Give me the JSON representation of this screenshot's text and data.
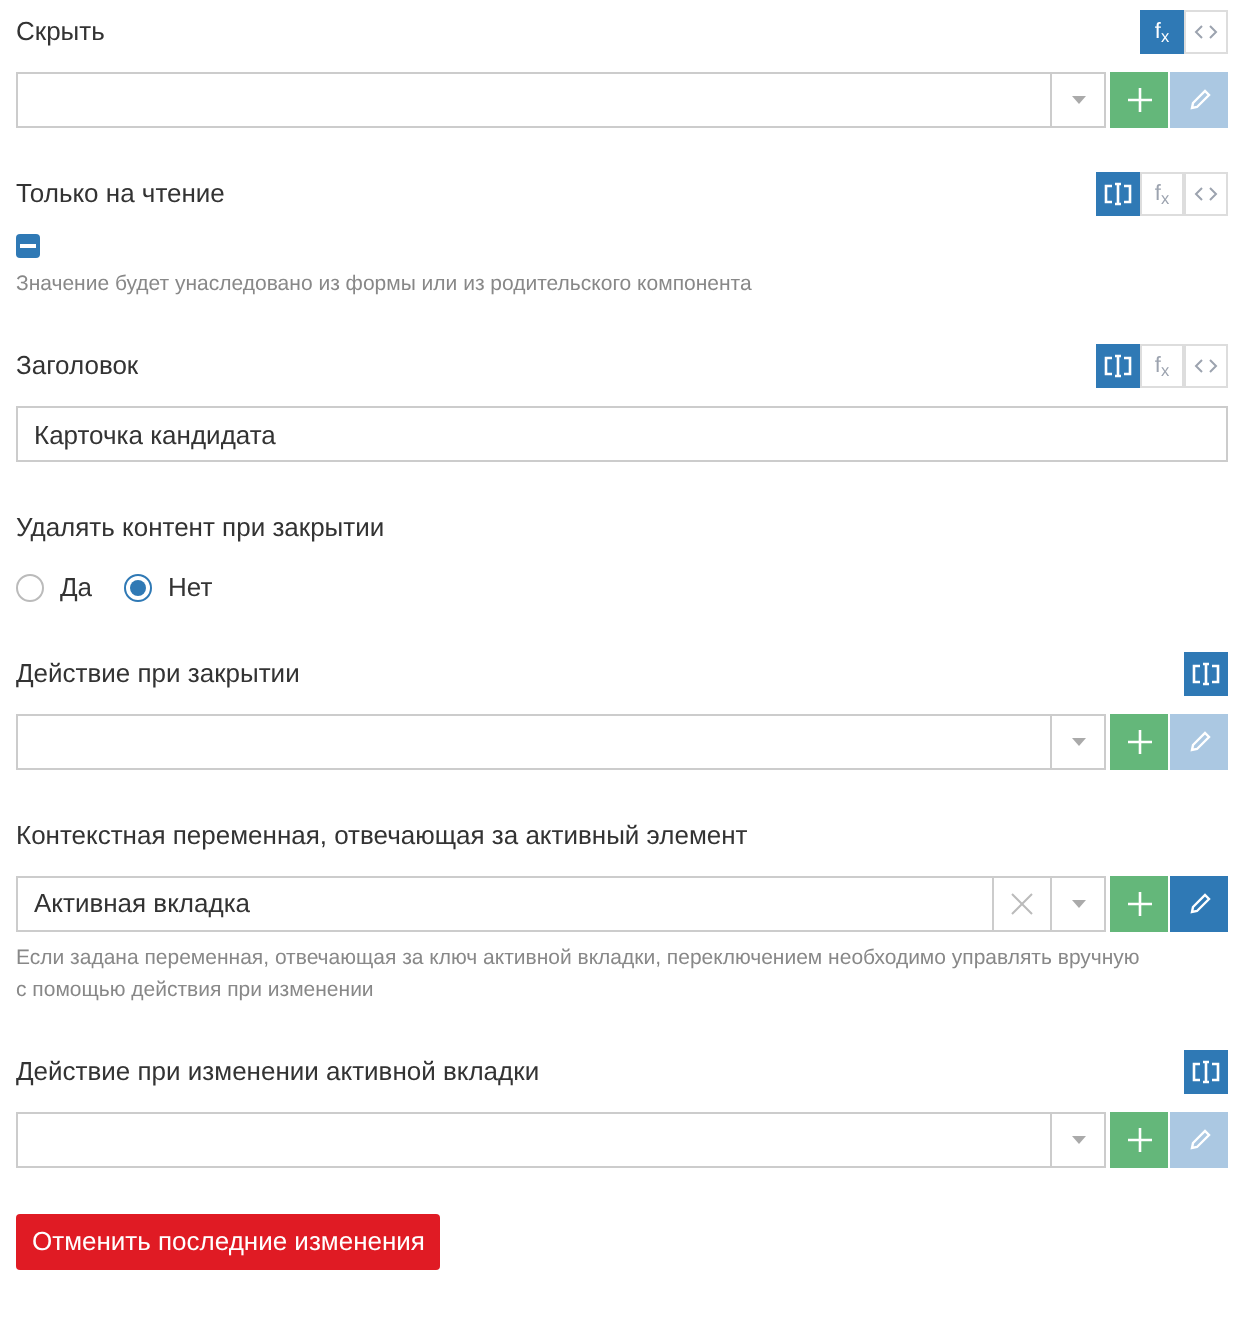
{
  "fields": [
    {
      "kind": "select",
      "label": "Скрыть",
      "modes": [
        {
          "kind": "fx",
          "label": "f$_{x}$",
          "selected": true
        },
        {
          "kind": "code",
          "selected": false
        }
      ],
      "clearable": false,
      "edit_disabled": true
    },
    {
      "kind": "checkbox",
      "label": "Только на чтение",
      "modes": [
        {
          "kind": "binding",
          "selected": true
        },
        {
          "kind": "fx",
          "label": "f$_{x}$",
          "selected": false
        },
        {
          "kind": "code",
          "selected": false
        }
      ],
      "indeterminate": true,
      "hint": "Значение будет унаследовано из формы или из родительского компонента"
    },
    {
      "kind": "text",
      "label": "Заголовок",
      "modes": [
        {
          "kind": "binding",
          "selected": true
        },
        {
          "kind": "fx",
          "label": "f$_{x}$",
          "selected": false
        },
        {
          "kind": "code",
          "selected": false
        }
      ],
      "value": "Карточка кандидата"
    },
    {
      "kind": "radio",
      "label": "Удалять контент при закрытии",
      "options": [
        {
          "label": "Да",
          "selected": false
        },
        {
          "label": "Нет",
          "selected": true
        }
      ]
    },
    {
      "kind": "select",
      "label": "Действие при закрытии",
      "modes": [
        {
          "kind": "binding",
          "selected": true
        }
      ],
      "clearable": false,
      "edit_disabled": true
    },
    {
      "kind": "select",
      "label": "Контекстная переменная, отвечающая за активный элемент",
      "value": "Активная вкладка",
      "clearable": true,
      "edit_disabled": false,
      "hint": "Если задана переменная, отвечающая за ключ активной вкладки, переключением необходимо управлять вручную с помощью действия при изменении"
    },
    {
      "kind": "select",
      "label": "Действие при изменении активной вкладки",
      "modes": [
        {
          "kind": "binding",
          "selected": true
        }
      ],
      "clearable": false,
      "edit_disabled": true
    }
  ],
  "reset_button": "Отменить последние изменения"
}
